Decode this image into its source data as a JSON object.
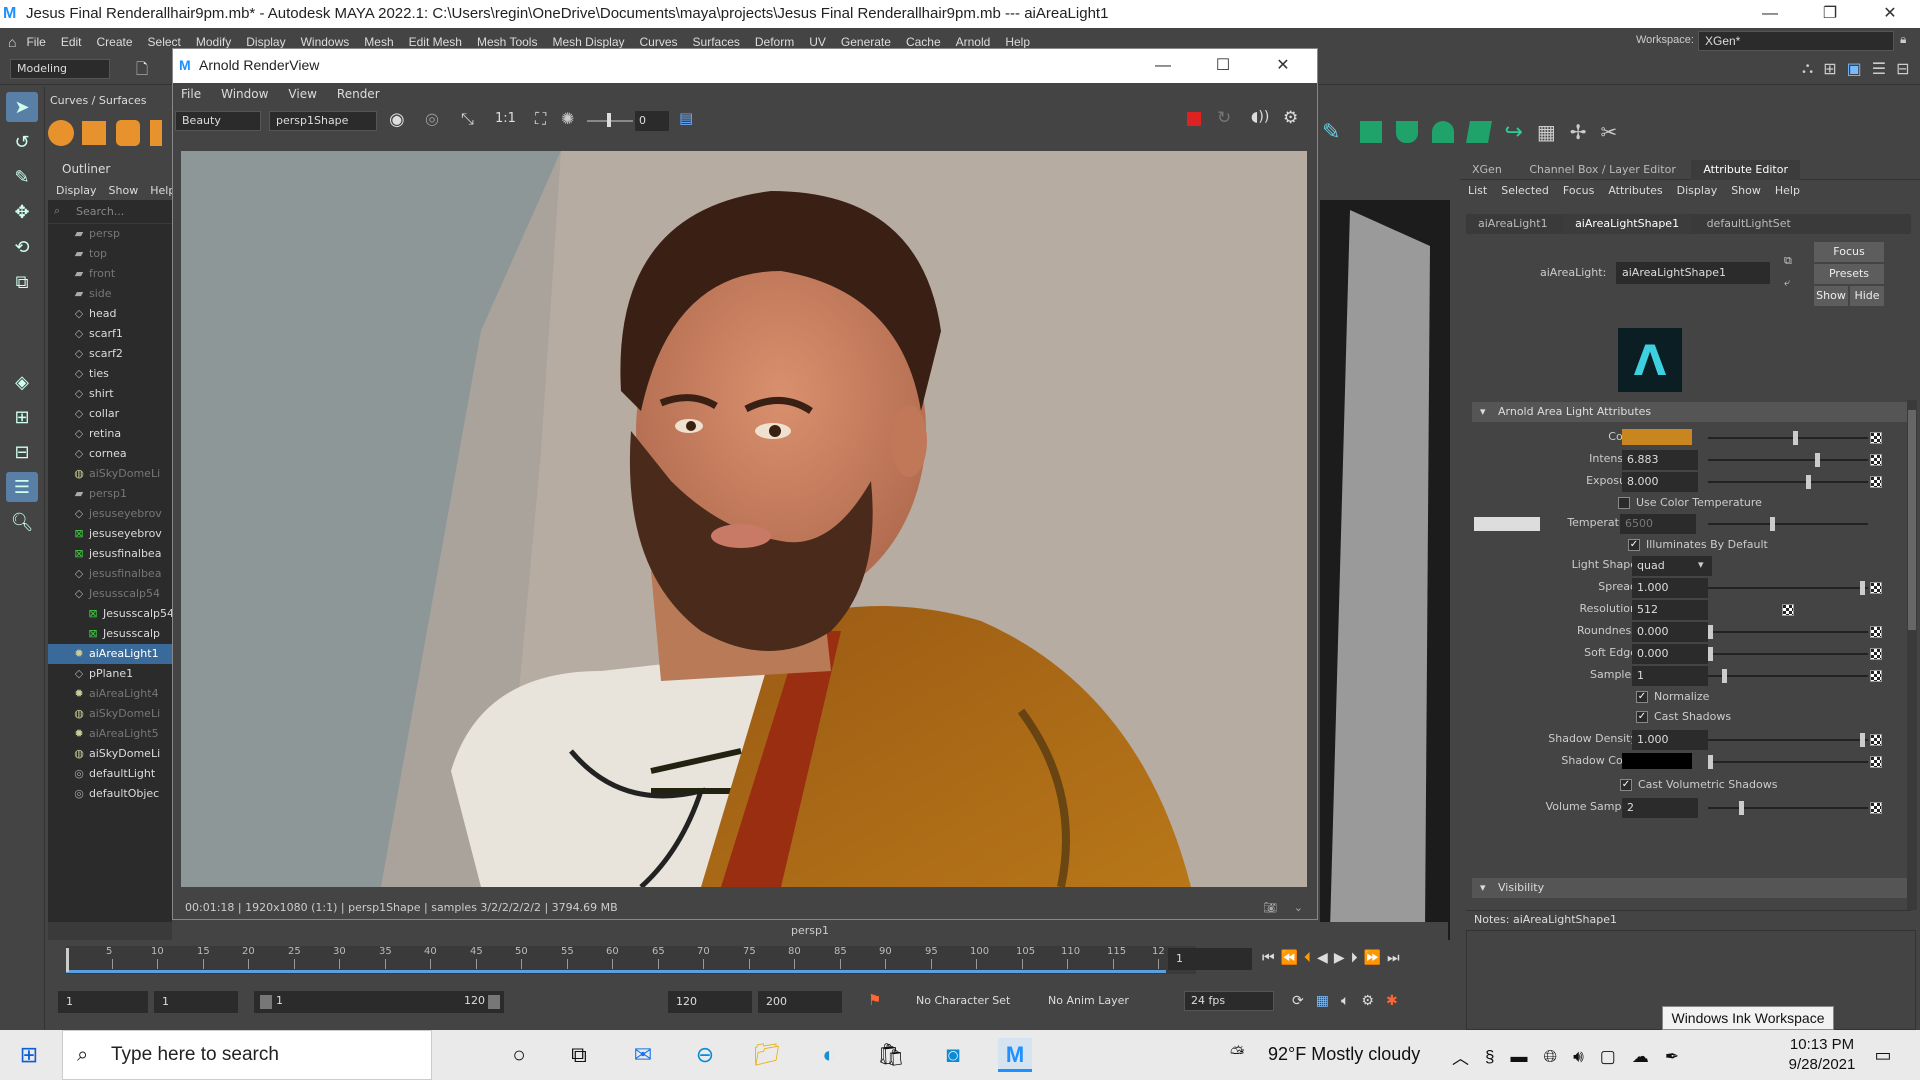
{
  "app": {
    "title": "Jesus Final Renderallhair9pm.mb* - Autodesk MAYA 2022.1: C:\\Users\\regin\\OneDrive\\Documents\\maya\\projects\\Jesus Final Renderallhair9pm.mb   ---   aiAreaLight1",
    "logo": "M"
  },
  "menu": [
    "File",
    "Edit",
    "Create",
    "Select",
    "Modify",
    "Display",
    "Windows",
    "Mesh",
    "Edit Mesh",
    "Mesh Tools",
    "Mesh Display",
    "Curves",
    "Surfaces",
    "Deform",
    "UV",
    "Generate",
    "Cache",
    "Arnold",
    "Help"
  ],
  "menuset": "Modeling",
  "workspace": {
    "label": "Workspace:",
    "value": "XGen*"
  },
  "shelf_tab": "Curves / Surfaces",
  "outliner": {
    "title": "Outliner",
    "menu": [
      "Display",
      "Show",
      "Help"
    ],
    "search_placeholder": "Search...",
    "items": [
      {
        "label": "persp",
        "icon": "camera-icon",
        "dim": true,
        "sel": false
      },
      {
        "label": "top",
        "icon": "camera-icon",
        "dim": true,
        "sel": false
      },
      {
        "label": "front",
        "icon": "camera-icon",
        "dim": true,
        "sel": false
      },
      {
        "label": "side",
        "icon": "camera-icon",
        "dim": true,
        "sel": false
      },
      {
        "label": "head",
        "icon": "mesh-icon",
        "dim": false,
        "sel": false
      },
      {
        "label": "scarf1",
        "icon": "mesh-icon",
        "dim": false,
        "sel": false
      },
      {
        "label": "scarf2",
        "icon": "mesh-icon",
        "dim": false,
        "sel": false
      },
      {
        "label": "ties",
        "icon": "mesh-icon",
        "dim": false,
        "sel": false
      },
      {
        "label": "shirt",
        "icon": "mesh-icon",
        "dim": false,
        "sel": false
      },
      {
        "label": "collar",
        "icon": "mesh-icon",
        "dim": false,
        "sel": false
      },
      {
        "label": "retina",
        "icon": "mesh-icon",
        "dim": false,
        "sel": false
      },
      {
        "label": "cornea",
        "icon": "mesh-icon",
        "dim": false,
        "sel": false
      },
      {
        "label": "aiSkyDomeLi",
        "icon": "skydome-icon",
        "dim": true,
        "sel": false
      },
      {
        "label": "persp1",
        "icon": "camera-icon",
        "dim": true,
        "sel": false
      },
      {
        "label": "jesuseyebrov",
        "icon": "mesh-icon",
        "dim": true,
        "sel": false
      },
      {
        "label": "jesuseyebrov",
        "icon": "xgen-icon",
        "dim": false,
        "sel": false
      },
      {
        "label": "jesusfinalbea",
        "icon": "xgen-icon",
        "dim": false,
        "sel": false
      },
      {
        "label": "jesusfinalbea",
        "icon": "mesh-icon",
        "dim": true,
        "sel": false
      },
      {
        "label": "Jesusscalp54",
        "icon": "mesh-icon",
        "dim": true,
        "sel": false
      },
      {
        "label": "Jesusscalp54",
        "icon": "xgen-icon",
        "dim": false,
        "sel": false
      },
      {
        "label": "Jesusscalp",
        "icon": "xgen-icon",
        "dim": false,
        "sel": false
      },
      {
        "label": "aiAreaLight1",
        "icon": "light-icon",
        "dim": false,
        "sel": true
      },
      {
        "label": "pPlane1",
        "icon": "mesh-icon",
        "dim": false,
        "sel": false
      },
      {
        "label": "aiAreaLight4",
        "icon": "light-icon",
        "dim": true,
        "sel": false
      },
      {
        "label": "aiSkyDomeLi",
        "icon": "skydome-icon",
        "dim": true,
        "sel": false
      },
      {
        "label": "aiAreaLight5",
        "icon": "light-icon",
        "dim": true,
        "sel": false
      },
      {
        "label": "aiSkyDomeLi",
        "icon": "skydome-icon",
        "dim": false,
        "sel": false
      },
      {
        "label": "defaultLight",
        "icon": "set-icon",
        "dim": false,
        "sel": false
      },
      {
        "label": "defaultObjec",
        "icon": "set-icon",
        "dim": false,
        "sel": false
      }
    ]
  },
  "renderview": {
    "title": "Arnold RenderView",
    "menu": [
      "File",
      "Window",
      "View",
      "Render"
    ],
    "aov": "Beauty",
    "camera": "persp1Shape",
    "ratio": "1:1",
    "exposure": "0",
    "status": "00:01:18 | 1920x1080 (1:1) | persp1Shape  | samples 3/2/2/2/2/2 | 3794.69 MB"
  },
  "viewport_label": "persp1",
  "panel_tabs": [
    "XGen",
    "Channel Box / Layer Editor",
    "Attribute Editor"
  ],
  "attr_menu": [
    "List",
    "Selected",
    "Focus",
    "Attributes",
    "Display",
    "Show",
    "Help"
  ],
  "node_tabs": [
    "aiAreaLight1",
    "aiAreaLightShape1",
    "defaultLightSet"
  ],
  "node": {
    "type_label": "aiAreaLight:",
    "name": "aiAreaLightShape1"
  },
  "buttons": {
    "focus": "Focus",
    "presets": "Presets",
    "show": "Show",
    "hide": "Hide"
  },
  "section": "Arnold Area Light Attributes",
  "section2": "Visibility",
  "attrs": {
    "color": {
      "label": "Color",
      "hex": "#c9861f",
      "slider": 0.55
    },
    "intensity": {
      "label": "Intensity",
      "value": "6.883",
      "slider": 0.69
    },
    "exposure": {
      "label": "Exposure",
      "value": "8.000",
      "slider": 0.63
    },
    "use_color_temp": {
      "label": "Use Color Temperature",
      "checked": false
    },
    "temperature": {
      "label": "Temperature",
      "value": "6500",
      "slider": 0.4
    },
    "illuminates": {
      "label": "Illuminates By Default",
      "checked": true
    },
    "light_shape": {
      "label": "Light Shape",
      "value": "quad"
    },
    "spread": {
      "label": "Spread",
      "value": "1.000",
      "slider": 0.98
    },
    "resolution": {
      "label": "Resolution",
      "value": "512"
    },
    "roundness": {
      "label": "Roundness",
      "value": "0.000",
      "slider": 0.0
    },
    "soft_edge": {
      "label": "Soft Edge",
      "value": "0.000",
      "slider": 0.0
    },
    "samples": {
      "label": "Samples",
      "value": "1",
      "slider": 0.09
    },
    "normalize": {
      "label": "Normalize",
      "checked": true
    },
    "cast_shadows": {
      "label": "Cast Shadows",
      "checked": true
    },
    "shadow_density": {
      "label": "Shadow Density",
      "value": "1.000",
      "slider": 0.98
    },
    "shadow_color": {
      "label": "Shadow Color",
      "hex": "#000000",
      "slider": 0.0
    },
    "cast_vol_shadows": {
      "label": "Cast Volumetric Shadows",
      "checked": true
    },
    "volume_samples": {
      "label": "Volume Samples",
      "value": "2",
      "slider": 0.2
    }
  },
  "notes": "Notes:  aiAreaLightShape1",
  "timeline": {
    "ticks": [
      "5",
      "10",
      "15",
      "20",
      "25",
      "30",
      "35",
      "40",
      "45",
      "50",
      "55",
      "60",
      "65",
      "70",
      "75",
      "80",
      "85",
      "90",
      "95",
      "100",
      "105",
      "110",
      "115",
      "12"
    ],
    "current": "1"
  },
  "range": {
    "start": "1",
    "start2": "1",
    "slider_start": "1",
    "slider_end": "120",
    "end": "120",
    "end2": "200",
    "char_set": "No Character Set",
    "anim_layer": "No Anim Layer",
    "fps": "24 fps"
  },
  "tooltip": "Windows Ink Workspace",
  "taskbar": {
    "search": "Type here to search",
    "weather": "92°F  Mostly cloudy",
    "time": "10:13 PM",
    "date": "9/28/2021"
  }
}
